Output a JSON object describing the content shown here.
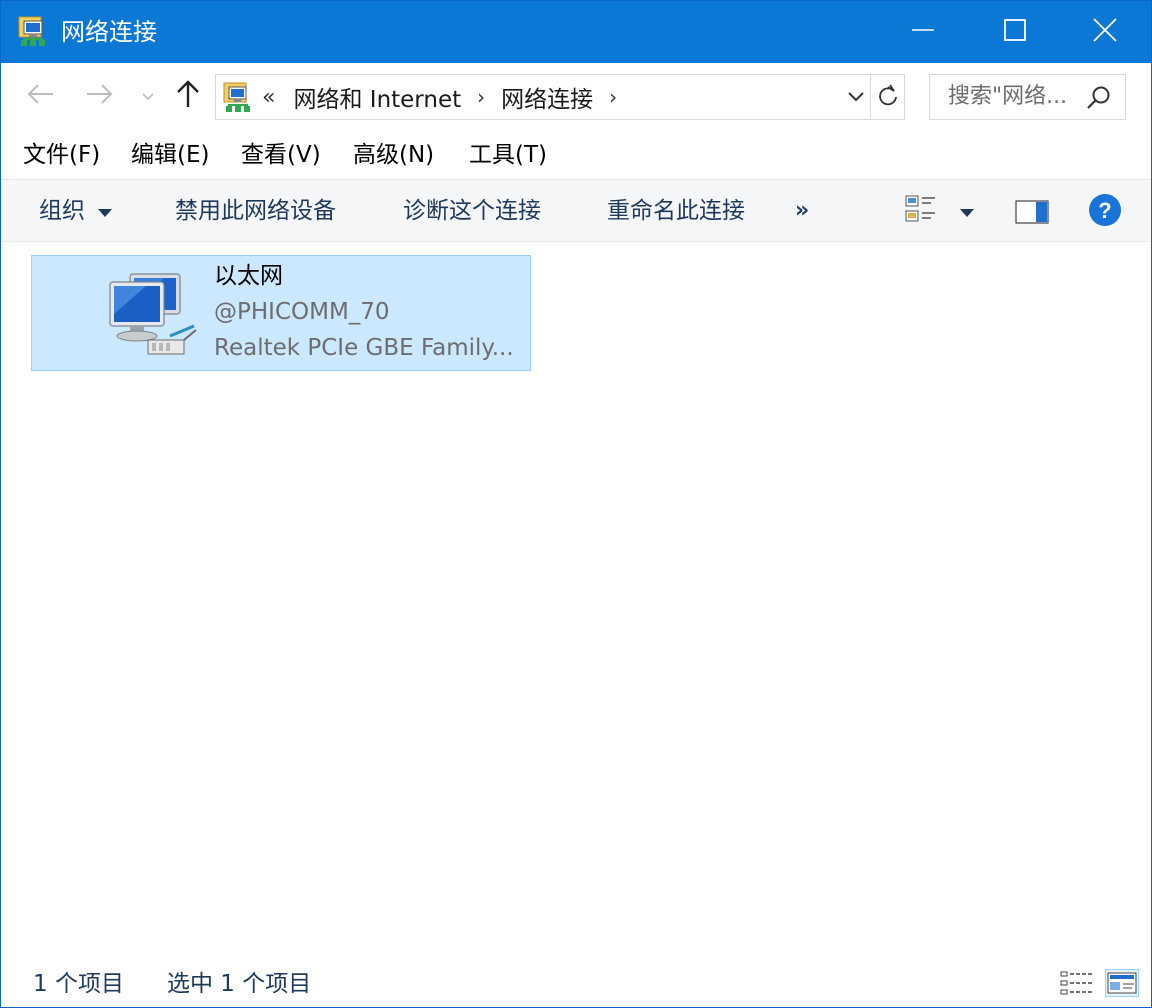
{
  "window": {
    "title": "网络连接",
    "icon": "network-connections-icon"
  },
  "titlebar": {
    "minimize_icon": "minimize-icon",
    "maximize_icon": "maximize-icon",
    "close_icon": "close-icon"
  },
  "nav": {
    "back_icon": "arrow-left-icon",
    "forward_icon": "arrow-right-icon",
    "recent_icon": "chevron-down-icon",
    "up_icon": "arrow-up-icon"
  },
  "address": {
    "lead": "«",
    "crumbs": [
      "网络和 Internet",
      "网络连接"
    ],
    "separator": "›",
    "refresh_icon": "refresh-icon"
  },
  "search": {
    "placeholder": "搜索\"网络...",
    "icon": "search-icon"
  },
  "menu": {
    "items": [
      "文件(F)",
      "编辑(E)",
      "查看(V)",
      "高级(N)",
      "工具(T)"
    ]
  },
  "commands": {
    "organize": "组织",
    "disable": "禁用此网络设备",
    "diagnose": "诊断这个连接",
    "rename": "重命名此连接",
    "more": "»",
    "help": "?"
  },
  "connections": [
    {
      "name": "以太网",
      "network": "@PHICOMM_70",
      "adapter": "Realtek PCIe GBE Family...",
      "selected": true,
      "icon": "ethernet-adapter-icon"
    }
  ],
  "status": {
    "count": "1 个项目",
    "selected": "选中 1 个项目"
  },
  "colors": {
    "titlebar": "#0c78d6",
    "selection_bg": "#cce8ff",
    "selection_border": "#99d1ff",
    "command_text": "#1e395b",
    "help_blue": "#1a73d6"
  }
}
